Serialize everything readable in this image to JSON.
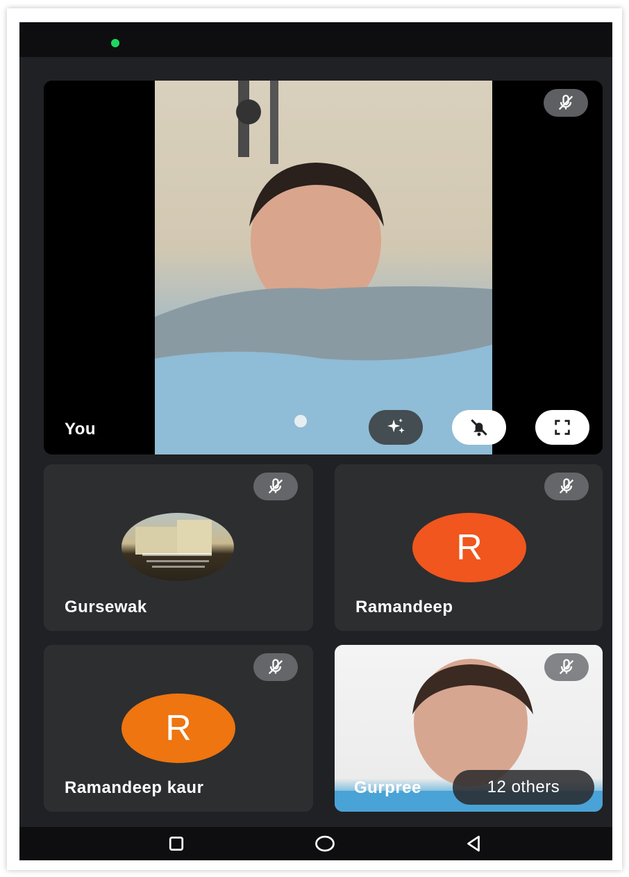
{
  "colors": {
    "background": "#202124",
    "tile": "#2d2e30",
    "status_dot": "#1ed760",
    "avatar_ramandeep": "#f0561e",
    "avatar_ramandeep_kaur": "#ee7510"
  },
  "participants": {
    "self": {
      "name": "You",
      "muted": true,
      "controls": [
        "effects-icon",
        "notifications-off-icon",
        "fullscreen-icon"
      ]
    },
    "tiles": [
      {
        "name": "Gursewak",
        "avatar_type": "photo",
        "muted": true
      },
      {
        "name": "Ramandeep",
        "avatar_letter": "R",
        "muted": true
      },
      {
        "name": "Ramandeep kaur",
        "avatar_letter": "R",
        "muted": true
      },
      {
        "name": "Gurpreet",
        "visible_name": "Gurpree",
        "avatar_type": "video",
        "muted": true
      }
    ],
    "others_label": "12 others"
  },
  "nav": {
    "buttons": [
      "recents-icon",
      "home-icon",
      "back-icon"
    ]
  }
}
